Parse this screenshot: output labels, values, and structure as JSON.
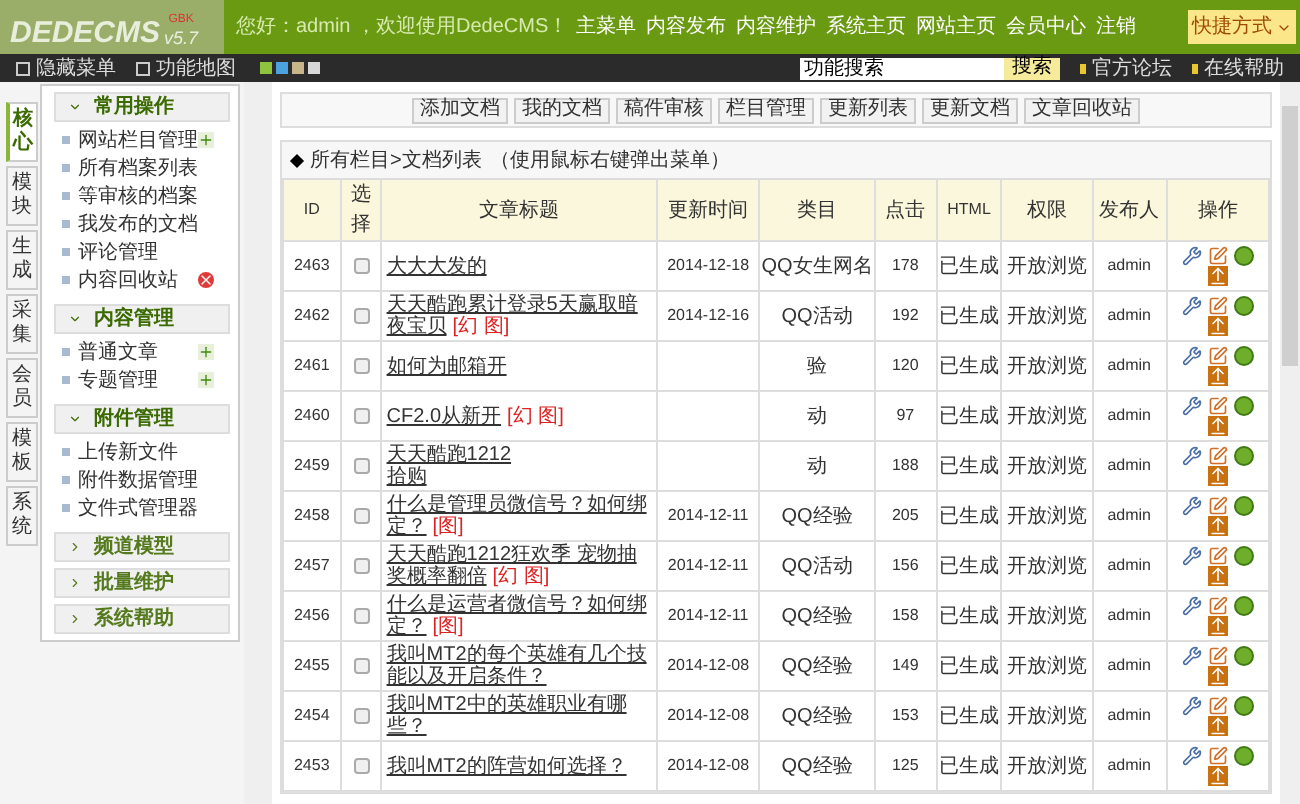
{
  "header": {
    "logo": "DEDECMS",
    "edition": "GBK",
    "version": "v5.7",
    "greeting": "您好：admin ，欢迎使用DedeCMS！",
    "nav": [
      "主菜单",
      "内容发布",
      "内容维护",
      "系统主页",
      "网站主页",
      "会员中心",
      "注销"
    ],
    "shortcut": "快捷方式"
  },
  "toolbar": {
    "hide_menu": "隐藏菜单",
    "feature_map": "功能地图",
    "skins": [
      {
        "color": "#8fc43f"
      },
      {
        "color": "#4aa3df"
      },
      {
        "color": "#c8b68a"
      },
      {
        "color": "#d8d8d8"
      }
    ],
    "search": {
      "value": "功能搜索",
      "button": "搜索"
    },
    "links": [
      "官方论坛",
      "在线帮助"
    ]
  },
  "side_tabs": [
    {
      "label": "核心",
      "selected": true
    },
    {
      "label": "模块",
      "selected": false
    },
    {
      "label": "生成",
      "selected": false
    },
    {
      "label": "采集",
      "selected": false
    },
    {
      "label": "会员",
      "selected": false
    },
    {
      "label": "模板",
      "selected": false
    },
    {
      "label": "系统",
      "selected": false
    }
  ],
  "menu_groups": [
    {
      "title": "常用操作",
      "expanded": true,
      "items": [
        {
          "label": "网站栏目管理",
          "kind": "add"
        },
        {
          "label": "所有档案列表",
          "kind": "plain"
        },
        {
          "label": "等审核的档案",
          "kind": "plain"
        },
        {
          "label": "我发布的文档",
          "kind": "plain"
        },
        {
          "label": "评论管理",
          "kind": "plain"
        },
        {
          "label": "内容回收站",
          "kind": "trash"
        }
      ]
    },
    {
      "title": "内容管理",
      "expanded": true,
      "items": [
        {
          "label": "普通文章",
          "kind": "add"
        },
        {
          "label": "专题管理",
          "kind": "add"
        }
      ]
    },
    {
      "title": "附件管理",
      "expanded": true,
      "items": [
        {
          "label": "上传新文件",
          "kind": "plain"
        },
        {
          "label": "附件数据管理",
          "kind": "plain"
        },
        {
          "label": "文件式管理器",
          "kind": "plain"
        }
      ]
    },
    {
      "title": "频道模型",
      "expanded": false
    },
    {
      "title": "批量维护",
      "expanded": false
    },
    {
      "title": "系统帮助",
      "expanded": false
    }
  ],
  "actions": [
    "添加文档",
    "我的文档",
    "稿件审核",
    "栏目管理",
    "更新列表",
    "更新文档",
    "文章回收站"
  ],
  "breadcrumb": {
    "path": "所有栏目>文档列表",
    "hint": "（使用鼠标右键弹出菜单）"
  },
  "table": {
    "columns": [
      "ID",
      "选择",
      "文章标题",
      "更新时间",
      "类目",
      "点击",
      "HTML",
      "权限",
      "发布人",
      "操作"
    ],
    "rows": [
      {
        "id": "2463",
        "checked": false,
        "title": "大大大发的",
        "date": "2014-12-18",
        "category": "QQ女生网名",
        "clicks": "178",
        "html": "已生成",
        "access": "开放浏览",
        "publisher": "admin"
      },
      {
        "id": "2462",
        "checked": false,
        "title": "天天酷跑累计登录5天赢取暗夜宝贝",
        "tag": "[幻 图]",
        "date": "2014-12-16",
        "category": "QQ活动",
        "clicks": "192",
        "html": "已生成",
        "access": "开放浏览",
        "publisher": "admin"
      },
      {
        "id": "2461",
        "checked": false,
        "title": "如何为邮箱开",
        "category": "验",
        "clicks": "120",
        "html": "已生成",
        "access": "开放浏览",
        "publisher": "admin"
      },
      {
        "id": "2460",
        "checked": false,
        "title": "CF2.0从新开",
        "tag": "[幻 图]",
        "category": "动",
        "clicks": "97",
        "html": "已生成",
        "access": "开放浏览",
        "publisher": "admin"
      },
      {
        "id": "2459",
        "checked": false,
        "title": "天天酷跑1212",
        "title_line2": "拾购",
        "category": "动",
        "clicks": "188",
        "html": "已生成",
        "access": "开放浏览",
        "publisher": "admin"
      },
      {
        "id": "2458",
        "checked": false,
        "title": "什么是管理员微信号？如何绑定？",
        "tag": "[图]",
        "date": "2014-12-11",
        "category": "QQ经验",
        "clicks": "205",
        "html": "已生成",
        "access": "开放浏览",
        "publisher": "admin"
      },
      {
        "id": "2457",
        "checked": false,
        "title": "天天酷跑1212狂欢季 宠物抽奖概率翻倍",
        "tag": "[幻 图]",
        "date": "2014-12-11",
        "category": "QQ活动",
        "clicks": "156",
        "html": "已生成",
        "access": "开放浏览",
        "publisher": "admin"
      },
      {
        "id": "2456",
        "checked": false,
        "title": "什么是运营者微信号？如何绑定？",
        "tag": "[图]",
        "date": "2014-12-11",
        "category": "QQ经验",
        "clicks": "158",
        "html": "已生成",
        "access": "开放浏览",
        "publisher": "admin"
      },
      {
        "id": "2455",
        "checked": false,
        "title": "我叫MT2的每个英雄有几个技能以及开启条件？",
        "date": "2014-12-08",
        "category": "QQ经验",
        "clicks": "149",
        "html": "已生成",
        "access": "开放浏览",
        "publisher": "admin"
      },
      {
        "id": "2454",
        "checked": false,
        "title": "我叫MT2中的英雄职业有哪些？",
        "date": "2014-12-08",
        "category": "QQ经验",
        "clicks": "153",
        "html": "已生成",
        "access": "开放浏览",
        "publisher": "admin"
      },
      {
        "id": "2453",
        "checked": false,
        "title": "我叫MT2的阵营如何选择？",
        "date": "2014-12-08",
        "category": "QQ经验",
        "clicks": "125",
        "html": "已生成",
        "access": "开放浏览",
        "publisher": "admin"
      }
    ]
  }
}
